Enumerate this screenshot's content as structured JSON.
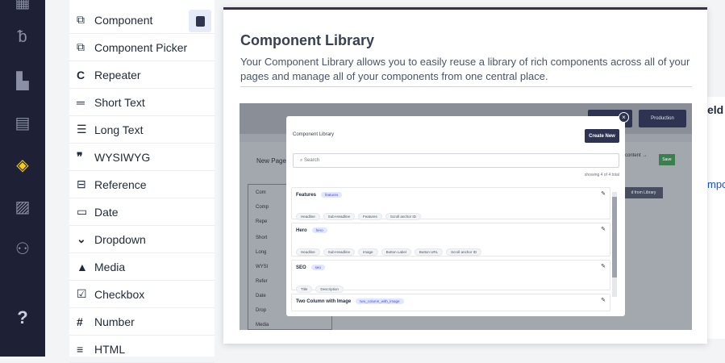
{
  "rail": {
    "items": [
      "flow-icon",
      "wifi-icon",
      "page-icon",
      "layout-icon",
      "cubes-icon",
      "media-icon",
      "users-icon"
    ],
    "active_color": "#facc15",
    "help": "?"
  },
  "field_types": [
    {
      "label": "Component",
      "icon": "layers-icon"
    },
    {
      "label": "Component Picker",
      "icon": "layers-plus-icon"
    },
    {
      "label": "Repeater",
      "icon": "repeat-icon"
    },
    {
      "label": "Short Text",
      "icon": "short-text-icon"
    },
    {
      "label": "Long Text",
      "icon": "long-text-icon"
    },
    {
      "label": "WYSIWYG",
      "icon": "quote-icon"
    },
    {
      "label": "Reference",
      "icon": "reference-icon"
    },
    {
      "label": "Date",
      "icon": "calendar-icon"
    },
    {
      "label": "Dropdown",
      "icon": "chevron-down-icon"
    },
    {
      "label": "Media",
      "icon": "image-icon"
    },
    {
      "label": "Checkbox",
      "icon": "checkbox-icon"
    },
    {
      "label": "Number",
      "icon": "hash-icon"
    },
    {
      "label": "HTML",
      "icon": "html-icon"
    }
  ],
  "popover": {
    "title": "Component Library",
    "description": "Your Component Library allows you to easily reuse a library of rich components across all of your pages and manage all of your components from one central place.",
    "accent": "#3b2f4d"
  },
  "behind": {
    "right_text_1": "eld",
    "right_text_2": "mpc"
  },
  "preview": {
    "production": "Production",
    "new_page": "New Page",
    "content_link": "content →",
    "save": "Save",
    "from_library": "d from Library",
    "bg_list": [
      "Com",
      "Comp",
      "Repe",
      "Short",
      "Long",
      "WYSI",
      "Refer",
      "Date",
      "Drop",
      "Media"
    ],
    "modal": {
      "title": "Component Library",
      "create": "Create New",
      "search": "Search",
      "showing": "showing 4 of 4 total",
      "rows": [
        {
          "name": "Features",
          "badge": "features",
          "chips": [
            "Headline",
            "Sub-Headline",
            "Features",
            "Scroll anchor ID"
          ]
        },
        {
          "name": "Hero",
          "badge": "hero",
          "chips": [
            "Headline",
            "Sub-Headline",
            "Image",
            "Button Label",
            "Button URL",
            "Scroll anchor ID"
          ]
        },
        {
          "name": "SEO",
          "badge": "seo",
          "chips": [
            "Title",
            "Description"
          ]
        },
        {
          "name": "Two Column with Image",
          "badge": "two_column_with_image",
          "chips": []
        }
      ]
    }
  }
}
